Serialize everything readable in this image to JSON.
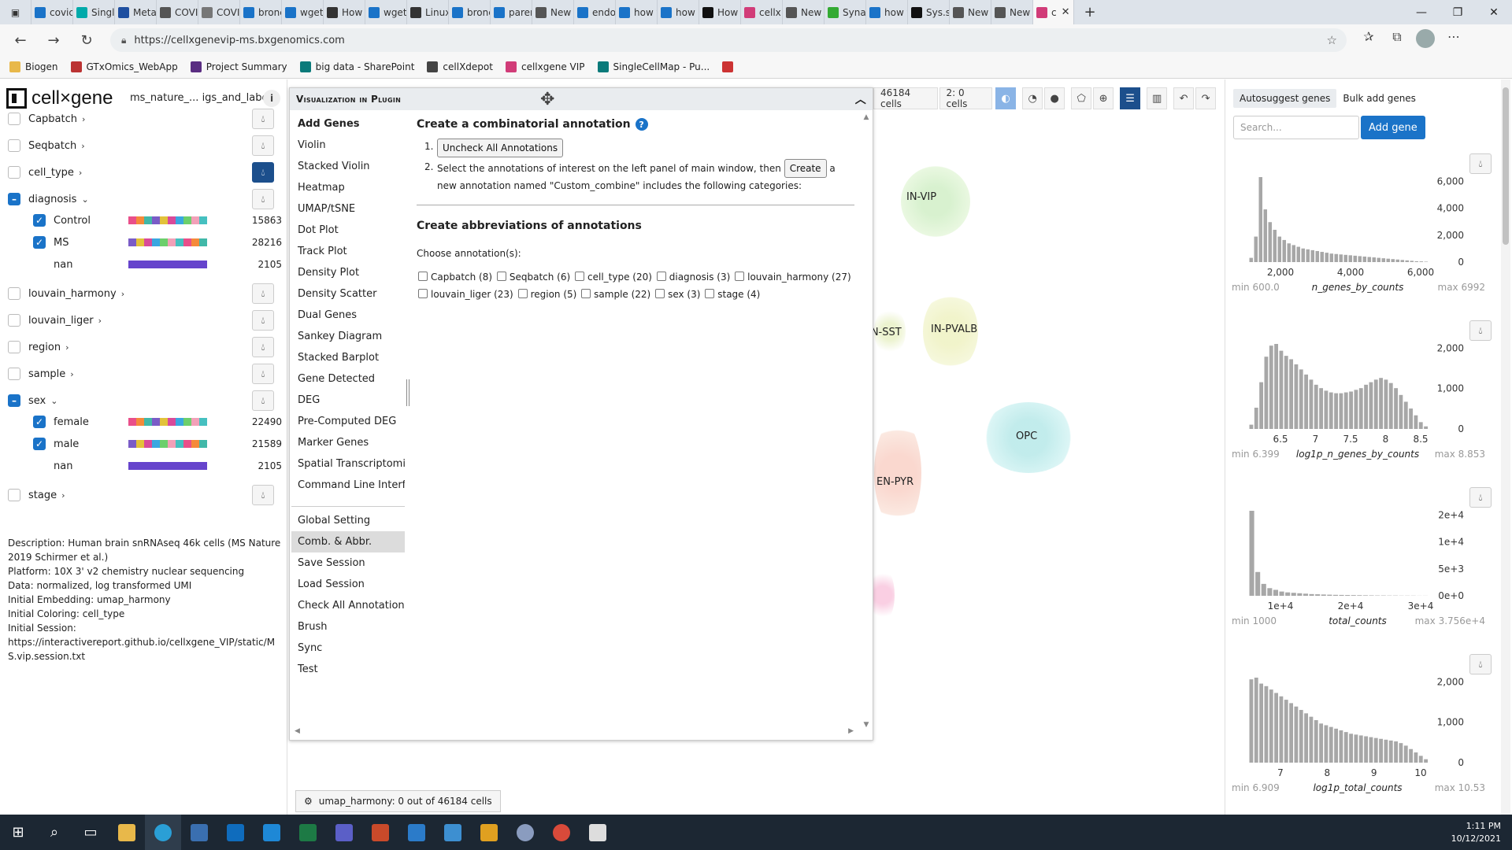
{
  "browser": {
    "tabs": [
      {
        "label": "covic",
        "color": "#1a73c8"
      },
      {
        "label": "Singl",
        "color": "#0aa"
      },
      {
        "label": "Meta",
        "color": "#1e4fa0"
      },
      {
        "label": "COVI",
        "color": "#555"
      },
      {
        "label": "COVI",
        "color": "#777"
      },
      {
        "label": "bronc",
        "color": "#1a73c8"
      },
      {
        "label": "wget",
        "color": "#1a73c8"
      },
      {
        "label": "How",
        "color": "#333"
      },
      {
        "label": "wget",
        "color": "#1a73c8"
      },
      {
        "label": "Linux",
        "color": "#333"
      },
      {
        "label": "bronc",
        "color": "#1a73c8"
      },
      {
        "label": "parer",
        "color": "#1a73c8"
      },
      {
        "label": "New",
        "color": "#555"
      },
      {
        "label": "endo",
        "color": "#1a73c8"
      },
      {
        "label": "how t",
        "color": "#1a73c8"
      },
      {
        "label": "how",
        "color": "#1a73c8"
      },
      {
        "label": "How",
        "color": "#111"
      },
      {
        "label": "cellx",
        "color": "#d13c78"
      },
      {
        "label": "New",
        "color": "#555"
      },
      {
        "label": "Syna",
        "color": "#3a3"
      },
      {
        "label": "how t",
        "color": "#1a73c8"
      },
      {
        "label": "Sys.s",
        "color": "#111"
      },
      {
        "label": "New",
        "color": "#555"
      },
      {
        "label": "New",
        "color": "#555"
      },
      {
        "label": "c",
        "color": "#d13c78"
      }
    ],
    "url": "https://cellxgenevip-ms.bxgenomics.com",
    "bookmarks": [
      {
        "label": "Biogen",
        "color": "#e8b84a"
      },
      {
        "label": "GTxOmics_WebApp",
        "color": "#b33"
      },
      {
        "label": "Project Summary",
        "color": "#5a2d82"
      },
      {
        "label": "big data - SharePoint",
        "color": "#0a7a7a"
      },
      {
        "label": "cellXdepot",
        "color": "#444"
      },
      {
        "label": "cellxgene VIP",
        "color": "#d13c78"
      },
      {
        "label": "SingleCellMap - Pu...",
        "color": "#0a7a7a"
      },
      {
        "label": "",
        "color": "#c33"
      }
    ]
  },
  "left": {
    "logo": "cell×gene",
    "dataset": "ms_nature_... igs_and_labels",
    "categories": [
      {
        "label": "Capbatch",
        "checked": false
      },
      {
        "label": "Seqbatch",
        "checked": false
      },
      {
        "label": "cell_type",
        "checked": false
      },
      {
        "label": "diagnosis",
        "checked": true
      },
      {
        "label": "louvain_harmony",
        "checked": false
      },
      {
        "label": "louvain_liger",
        "checked": false
      },
      {
        "label": "region",
        "checked": false
      },
      {
        "label": "sample",
        "checked": false
      },
      {
        "label": "sex",
        "checked": true
      },
      {
        "label": "stage",
        "checked": false
      }
    ],
    "diagnosis_values": [
      {
        "label": "Control",
        "count": "15863"
      },
      {
        "label": "MS",
        "count": "28216"
      },
      {
        "label": "nan",
        "count": "2105"
      }
    ],
    "sex_values": [
      {
        "label": "female",
        "count": "22490"
      },
      {
        "label": "male",
        "count": "21589"
      },
      {
        "label": "nan",
        "count": "2105"
      }
    ],
    "description": [
      "Description: Human brain snRNAseq 46k cells (MS Nature 2019 Schirmer et al.)",
      "Platform: 10X 3' v2 chemistry nuclear sequencing",
      "Data: normalized, log transformed UMI",
      "Initial Embedding: umap_harmony",
      "Initial Coloring: cell_type",
      "Initial Session:",
      "https://interactivereport.github.io/cellxgene_VIP/static/MS.vip.session.txt"
    ]
  },
  "plugin": {
    "title": "Visualization in Plugin",
    "menu1": [
      "Add Genes",
      "Violin",
      "Stacked Violin",
      "Heatmap",
      "UMAP/tSNE",
      "Dot Plot",
      "Track Plot",
      "Density Plot",
      "Density Scatter",
      "Dual Genes",
      "Sankey Diagram",
      "Stacked Barplot",
      "Gene Detected",
      "DEG",
      "Pre-Computed DEG",
      "Marker Genes",
      "Spatial Transcriptomics",
      "Command Line Interface"
    ],
    "menu2": [
      "Global Setting",
      "Comb. & Abbr.",
      "Save Session",
      "Load Session",
      "Check All Annotations",
      "Brush",
      "Sync",
      "Test"
    ],
    "comb_title": "Create a combinatorial annotation",
    "uncheck_btn": "Uncheck All Annotations",
    "step2_pre": "Select the annotations of interest on the left panel of main window, then",
    "create_btn": "Create",
    "step2_post": "a new annotation named \"Custom_combine\" includes the following categories:",
    "abbr_title": "Create abbreviations of annotations",
    "choose_label": "Choose annotation(s):",
    "annotations": [
      "Capbatch (8)",
      "Seqbatch (6)",
      "cell_type (20)",
      "diagnosis (3)",
      "louvain_harmony (27)",
      "louvain_liger (23)",
      "region (5)",
      "sample (22)",
      "sex (3)",
      "stage (4)"
    ]
  },
  "toolbar": {
    "cells": "46184 cells",
    "selection": "2: 0 cells"
  },
  "embedding": {
    "labels": [
      "IN-VIP",
      "IN-SST",
      "IN-PVALB",
      "OPC",
      "EN-PYR"
    ],
    "footer": "umap_harmony: 0 out of 46184 cells"
  },
  "right": {
    "tabs": [
      "Autosuggest genes",
      "Bulk add genes"
    ],
    "search_placeholder": "Search...",
    "add_gene": "Add gene",
    "histograms": [
      {
        "name": "n_genes_by_counts",
        "min": "min 600.0",
        "max": "max 6992",
        "xticks": [
          "2,000",
          "4,000",
          "6,000"
        ],
        "yticks": [
          "6,000",
          "4,000",
          "2,000",
          "0"
        ],
        "values": [
          0.05,
          0.3,
          1.0,
          0.62,
          0.47,
          0.38,
          0.3,
          0.26,
          0.22,
          0.2,
          0.18,
          0.16,
          0.15,
          0.14,
          0.13,
          0.12,
          0.11,
          0.1,
          0.095,
          0.09,
          0.085,
          0.08,
          0.075,
          0.07,
          0.065,
          0.06,
          0.055,
          0.05,
          0.045,
          0.04,
          0.035,
          0.03,
          0.025,
          0.02,
          0.015,
          0.01,
          0.008,
          0.005
        ]
      },
      {
        "name": "log1p_n_genes_by_counts",
        "min": "min 6.399",
        "max": "max 8.853",
        "xticks": [
          "6.5",
          "7",
          "7.5",
          "8",
          "8.5"
        ],
        "yticks": [
          "2,000",
          "1,000",
          "0"
        ],
        "values": [
          0.05,
          0.25,
          0.55,
          0.85,
          0.98,
          1.0,
          0.92,
          0.86,
          0.82,
          0.76,
          0.7,
          0.64,
          0.58,
          0.52,
          0.48,
          0.45,
          0.43,
          0.42,
          0.42,
          0.43,
          0.44,
          0.46,
          0.48,
          0.52,
          0.55,
          0.58,
          0.6,
          0.58,
          0.54,
          0.48,
          0.4,
          0.32,
          0.24,
          0.16,
          0.08,
          0.03
        ]
      },
      {
        "name": "total_counts",
        "min": "min 1000",
        "max": "max 3.756e+4",
        "xticks": [
          "1e+4",
          "2e+4",
          "3e+4"
        ],
        "yticks": [
          "2e+4",
          "1e+4",
          "5e+3",
          "0e+0"
        ],
        "values": [
          1.0,
          0.28,
          0.14,
          0.09,
          0.07,
          0.05,
          0.04,
          0.035,
          0.03,
          0.025,
          0.02,
          0.018,
          0.015,
          0.013,
          0.011,
          0.01,
          0.009,
          0.008,
          0.007,
          0.006,
          0.005,
          0.004,
          0.004,
          0.003,
          0.003,
          0.002,
          0.002,
          0.002,
          0.001,
          0.001
        ]
      },
      {
        "name": "log1p_total_counts",
        "min": "min 6.909",
        "max": "max 10.53",
        "xticks": [
          "7",
          "8",
          "9",
          "10"
        ],
        "yticks": [
          "2,000",
          "1,000",
          "0"
        ],
        "values": [
          0.98,
          1.0,
          0.93,
          0.9,
          0.86,
          0.82,
          0.78,
          0.74,
          0.7,
          0.66,
          0.62,
          0.58,
          0.54,
          0.5,
          0.46,
          0.44,
          0.42,
          0.4,
          0.38,
          0.36,
          0.34,
          0.33,
          0.32,
          0.31,
          0.3,
          0.29,
          0.28,
          0.27,
          0.26,
          0.25,
          0.23,
          0.2,
          0.16,
          0.12,
          0.08,
          0.04
        ]
      }
    ]
  },
  "taskbar": {
    "time": "1:11 PM",
    "date": "10/12/2021"
  },
  "colors": {
    "accent": "#1a73c8",
    "dark_accent": "#1c4f8c"
  }
}
